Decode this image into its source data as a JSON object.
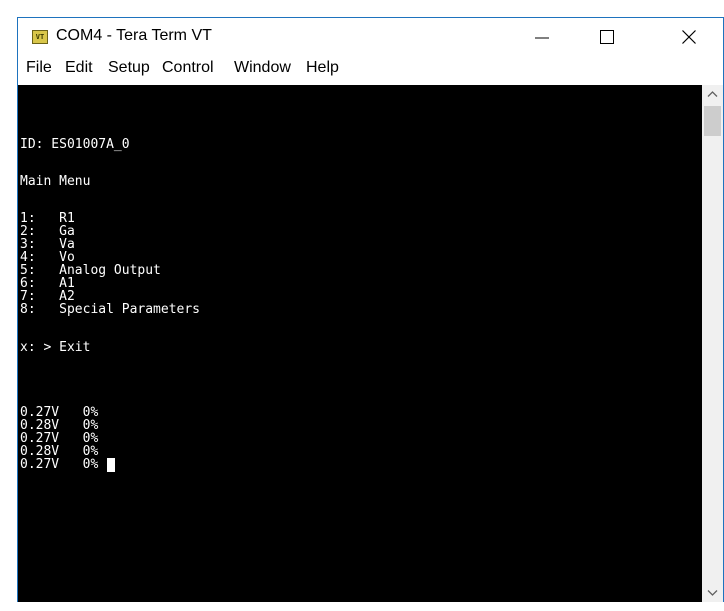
{
  "window": {
    "title": "COM4 - Tera Term VT",
    "icon_text": "VT"
  },
  "menu": [
    "File",
    "Edit",
    "Setup",
    "Control",
    "Window",
    "Help"
  ],
  "terminal": {
    "lines": [
      "ID: ES01007A_0",
      "Main Menu",
      "1:   R1",
      "2:   Ga",
      "3:   Va",
      "4:   Vo",
      "5:   Analog Output",
      "6:   A1",
      "7:   A2",
      "8:   Special Parameters",
      "x: > Exit",
      "0.27V   0%",
      "0.28V   0%",
      "0.27V   0%",
      "0.28V   0%",
      "0.27V   0%"
    ]
  },
  "icons": {
    "minimize": "minimize-icon",
    "maximize": "maximize-icon",
    "close": "close-icon",
    "scroll_up": "chevron-up-icon",
    "scroll_down": "chevron-down-icon"
  },
  "colors": {
    "terminal_bg": "#000000",
    "terminal_fg": "#ffffff",
    "window_border": "#1e73be"
  }
}
